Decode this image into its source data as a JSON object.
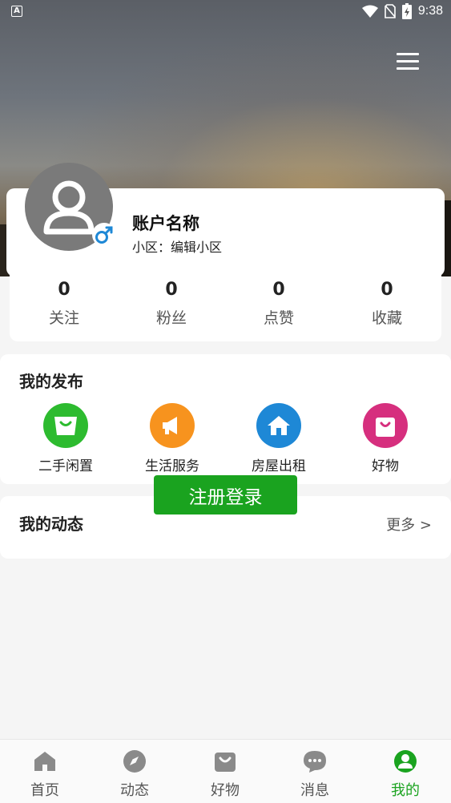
{
  "status_bar": {
    "time": "9:38",
    "app_indicator": "A"
  },
  "profile": {
    "account_name": "账户名称",
    "community_label": "小区：编辑小区"
  },
  "stats": [
    {
      "count": "0",
      "label": "关注"
    },
    {
      "count": "0",
      "label": "粉丝"
    },
    {
      "count": "0",
      "label": "点赞"
    },
    {
      "count": "0",
      "label": "收藏"
    }
  ],
  "publish": {
    "title": "我的发布",
    "items": [
      {
        "label": "二手闲置",
        "icon": "bag-icon",
        "color": "#2dbb2f"
      },
      {
        "label": "生活服务",
        "icon": "megaphone-icon",
        "color": "#f7931e"
      },
      {
        "label": "房屋出租",
        "icon": "house-icon",
        "color": "#1e88d6"
      },
      {
        "label": "好物",
        "icon": "shopping-bag-icon",
        "color": "#d62f7e"
      }
    ]
  },
  "dynamics": {
    "title": "我的动态",
    "more": "更多 >"
  },
  "register_button": "注册登录",
  "tabbar": {
    "items": [
      {
        "label": "首页",
        "icon": "home-icon"
      },
      {
        "label": "动态",
        "icon": "compass-icon"
      },
      {
        "label": "好物",
        "icon": "bag-icon"
      },
      {
        "label": "消息",
        "icon": "chat-icon"
      },
      {
        "label": "我的",
        "icon": "user-icon",
        "active": true
      }
    ]
  },
  "colors": {
    "accent": "#1aa31f",
    "avatar_bg": "#7a7a7a",
    "gender": "#1e88d6"
  }
}
